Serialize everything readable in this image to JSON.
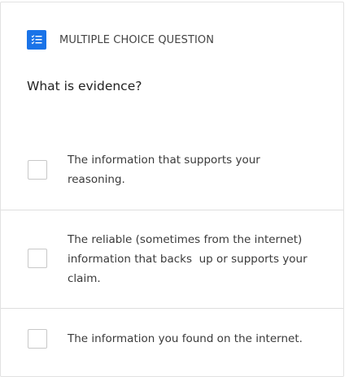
{
  "question_card": {
    "type_label": "MULTIPLE CHOICE QUESTION",
    "type_icon": "checklist-icon",
    "accent_color": "#1a73e8",
    "question_text": "What is evidence?",
    "options": [
      {
        "text": "The information that supports your reasoning.",
        "checked": false
      },
      {
        "text": "The reliable (sometimes from the internet) information that backs  up or supports your claim.",
        "checked": false
      },
      {
        "text": "The information you found on the internet.",
        "checked": false
      }
    ]
  }
}
